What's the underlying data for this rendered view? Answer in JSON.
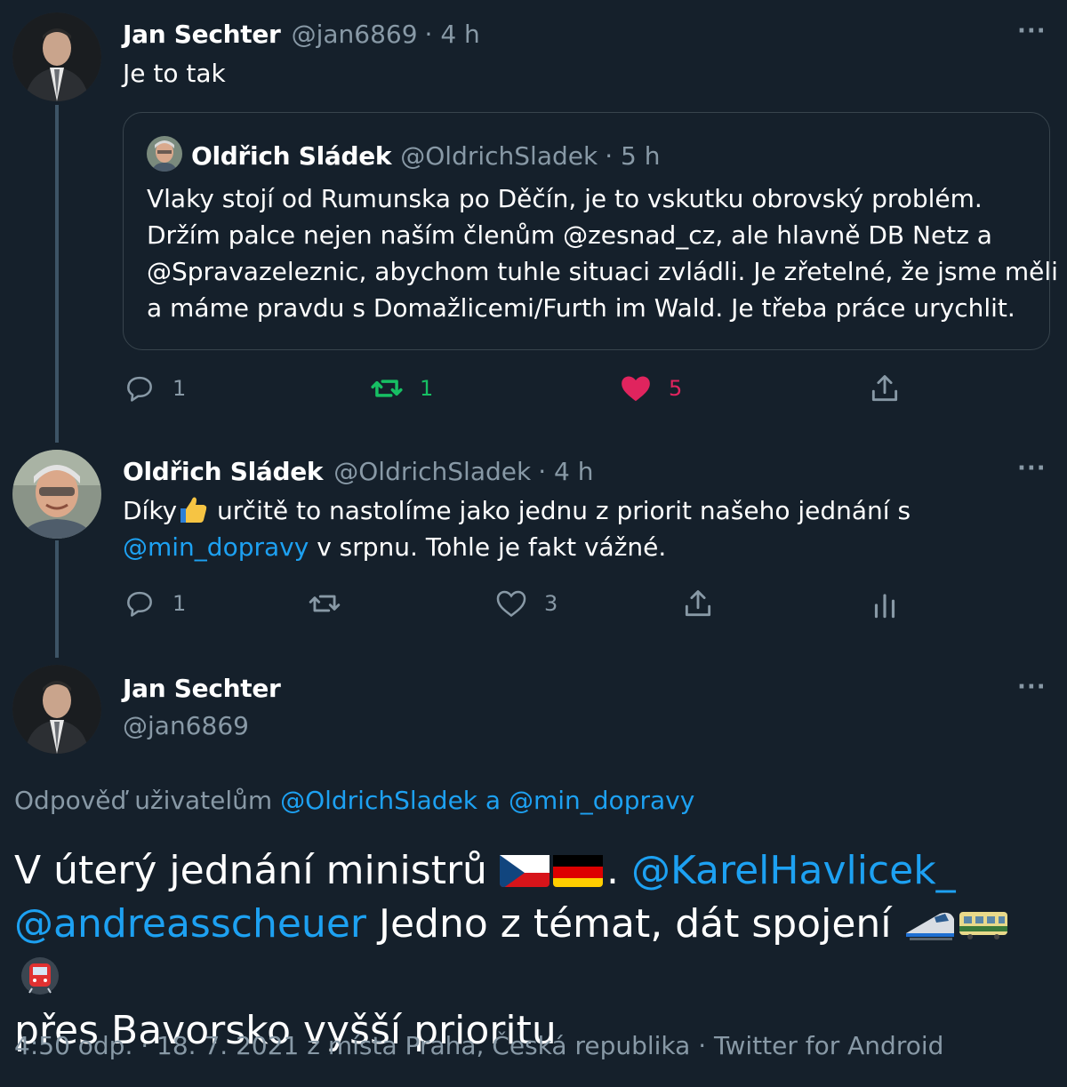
{
  "tweet1": {
    "author_name": "Jan Sechter",
    "handle": "@jan6869",
    "time": "· 4 h",
    "text": "Je to tak",
    "quoted": {
      "author_name": "Oldřich Sládek",
      "handle": "@OldrichSladek",
      "time": "· 5 h",
      "text_line1": "Vlaky stojí od Rumunska po Děčín, je to vskutku obrovský problém.",
      "text_line2": "Držím  palce nejen naším členům @zesnad_cz, ale hlavně DB Netz a",
      "text_line3": "@Spravazeleznic, abychom tuhle situaci zvládli. Je zřetelné, že jsme měli",
      "text_line4": "a máme pravdu s Domažlicemi/Furth im Wald. Je třeba práce urychlit."
    },
    "actions": {
      "replies": "1",
      "retweets": "1",
      "likes": "5"
    },
    "colors": {
      "retweet": "#17bf63",
      "like": "#e0245e"
    }
  },
  "tweet2": {
    "author_name": "Oldřich Sládek",
    "handle": "@OldrichSladek",
    "time": "· 4 h",
    "text_part1": "Díky",
    "thumb_icon": "thumbs-up-emoji",
    "text_part2": " určitě to nastolíme jako jednu z priorit našeho jednání s",
    "mention": "@min_dopravy",
    "text_part3": " v srpnu. Tohle je fakt vážné.",
    "actions": {
      "replies": "1",
      "likes": "3"
    }
  },
  "main_tweet": {
    "author_name": "Jan Sechter",
    "handle": "@jan6869",
    "reply_prefix": "Odpověď uživatelům",
    "reply_mention1": "@OldrichSladek",
    "reply_and": " a ",
    "reply_mention2": "@min_dopravy",
    "text_part1": "V úterý jednání ministrů",
    "flags": [
      "czech-flag",
      "german-flag"
    ],
    "text_dot": ".",
    "mention1": "@KarelHavlicek_",
    "mention2": "@andreasscheuer",
    "text_part2": " Jedno z témat, dát spojení",
    "train_icons": [
      "high-speed-train-emoji",
      "railway-car-emoji",
      "metro-emoji"
    ],
    "text_part3": "přes Bavorsko vyšší prioritu",
    "meta": "4:50 odp. · 18. 7. 2021 z místa Praha, Česká republika · Twitter for Android"
  },
  "more_icon": "···",
  "colors": {
    "background": "#15202b",
    "muted": "#8899a6",
    "link": "#1da1f2",
    "border": "#38444d"
  }
}
